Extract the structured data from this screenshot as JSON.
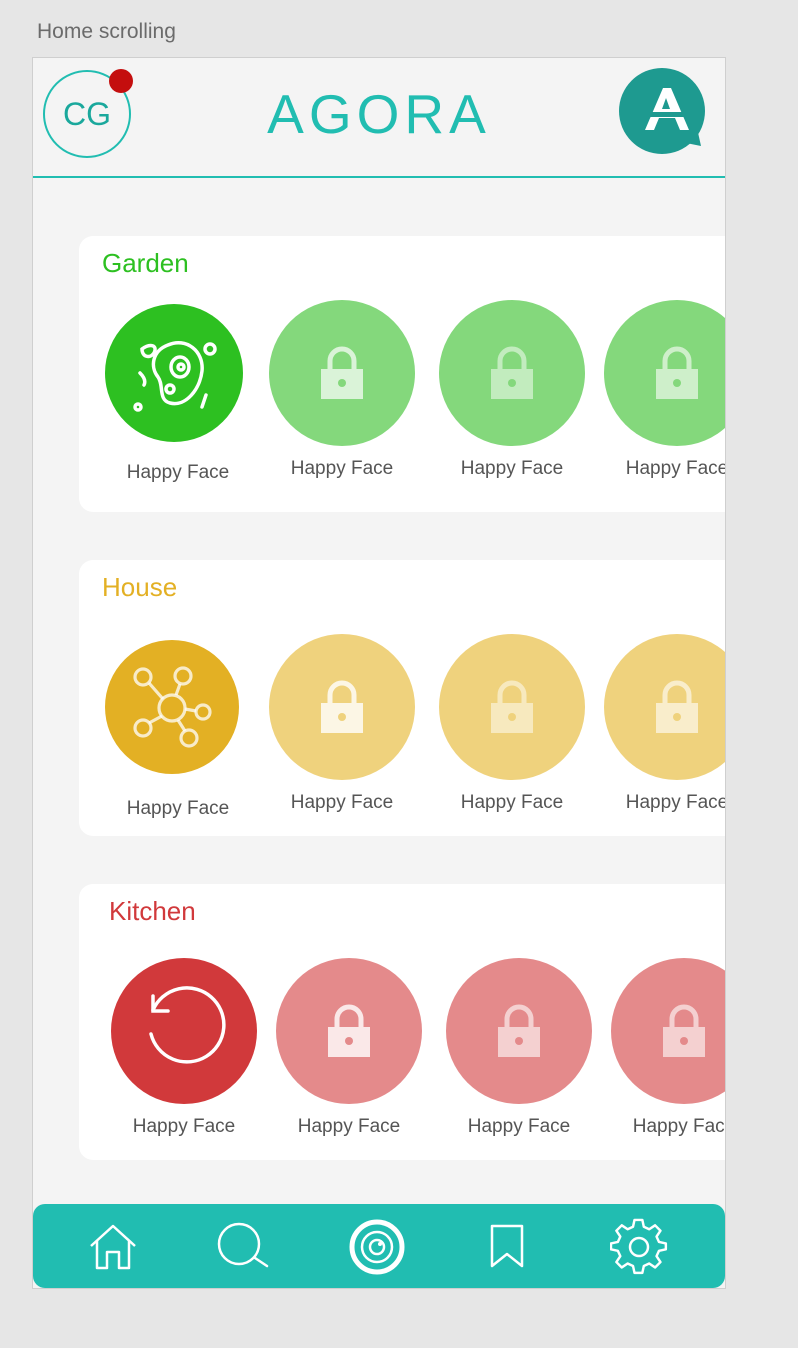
{
  "frame_label": "Home scrolling",
  "header": {
    "avatar_initials": "CG",
    "title": "AGORA",
    "logo_icon": "agora-logo-icon"
  },
  "colors": {
    "accent": "#21bdb1",
    "garden": "#2dc021",
    "garden_locked": "#84d87c",
    "house": "#e3b024",
    "house_locked": "#efd27d",
    "kitchen": "#d1393b",
    "kitchen_locked": "#e48a8b",
    "notification": "#c40e0e"
  },
  "sections": [
    {
      "title": "Garden",
      "badges": [
        {
          "label": "Happy Face",
          "icon": "bacteria-icon",
          "locked": false
        },
        {
          "label": "Happy Face",
          "icon": "lock-icon",
          "locked": true
        },
        {
          "label": "Happy Face",
          "icon": "lock-icon",
          "locked": true
        },
        {
          "label": "Happy Face",
          "icon": "lock-icon",
          "locked": true
        }
      ]
    },
    {
      "title": "House",
      "badges": [
        {
          "label": "Happy Face",
          "icon": "molecule-icon",
          "locked": false
        },
        {
          "label": "Happy Face",
          "icon": "lock-icon",
          "locked": true
        },
        {
          "label": "Happy Face",
          "icon": "lock-icon",
          "locked": true
        },
        {
          "label": "Happy Face",
          "icon": "lock-icon",
          "locked": true
        }
      ]
    },
    {
      "title": "Kitchen",
      "badges": [
        {
          "label": "Happy Face",
          "icon": "refresh-icon",
          "locked": false
        },
        {
          "label": "Happy Face",
          "icon": "lock-icon",
          "locked": true
        },
        {
          "label": "Happy Face",
          "icon": "lock-icon",
          "locked": true
        },
        {
          "label": "Happy Face",
          "icon": "lock-icon",
          "locked": true
        }
      ]
    }
  ],
  "nav": {
    "items": [
      {
        "icon": "home-icon"
      },
      {
        "icon": "search-icon"
      },
      {
        "icon": "camera-icon"
      },
      {
        "icon": "bookmark-icon"
      },
      {
        "icon": "gear-icon"
      }
    ]
  }
}
